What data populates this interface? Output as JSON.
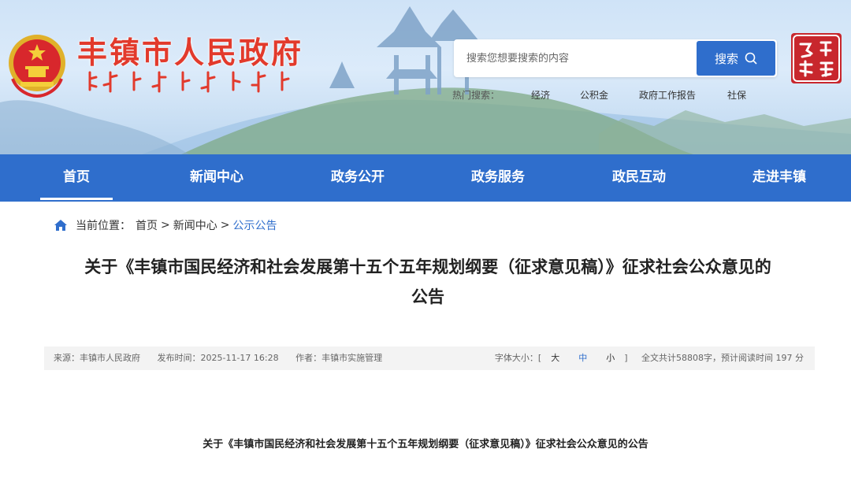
{
  "colors": {
    "primary": "#2f6ecc",
    "brand_red": "#e23a2c",
    "seal_red": "#c8272d"
  },
  "header": {
    "site_title": "丰镇市人民政府",
    "emblem_icon": "national-emblem-icon",
    "seal_icon": "red-seal-logo-icon",
    "search": {
      "placeholder": "搜索您想要搜索的内容",
      "button_label": "搜索",
      "button_icon": "search-icon"
    },
    "hot_search": {
      "label": "热门搜索：",
      "links": [
        "经济",
        "公积金",
        "政府工作报告",
        "社保"
      ]
    }
  },
  "nav": {
    "items": [
      "首页",
      "新闻中心",
      "政务公开",
      "政务服务",
      "政民互动",
      "走进丰镇"
    ],
    "active": "首页"
  },
  "breadcrumb": {
    "icon": "home-icon",
    "label": "当前位置：",
    "crumbs": [
      "首页",
      "新闻中心",
      "公示公告"
    ],
    "separator": ">"
  },
  "article": {
    "title_line1": "关于《丰镇市国民经济和社会发展第十五个五年规划纲要（征求意见稿）》征求社会公众意见的",
    "title_line2": "公告",
    "meta": {
      "source": "来源：丰镇市人民政府",
      "published": "发布时间：2025-11-17 16:28",
      "author": "作者：丰镇市实施管理",
      "font_size_label": "字体大小：[",
      "font_size_close": "]",
      "font_sizes": [
        "大",
        "中",
        "小"
      ],
      "font_size_selected": "中",
      "word_count": "全文共计58808字，预计阅读时间 197 分"
    },
    "body_heading": "关于《丰镇市国民经济和社会发展第十五个五年规划纲要（征求意见稿）》征求社会公众意见的公告"
  }
}
